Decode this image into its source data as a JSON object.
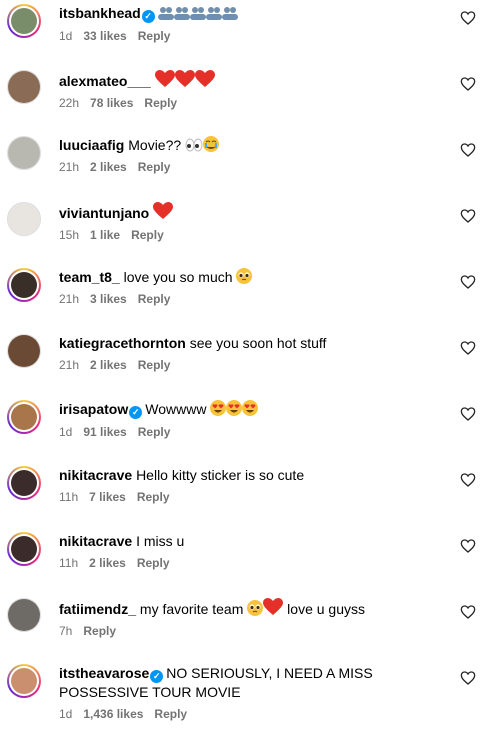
{
  "comments": [
    {
      "username": "itsbankhead",
      "verified": true,
      "text": "",
      "emoji": [
        "people",
        "people",
        "people",
        "people",
        "people"
      ],
      "time": "1d",
      "likes": "33 likes",
      "reply": "Reply",
      "avatar_color": "#7a8d6b",
      "story": true
    },
    {
      "username": "alexmateo___",
      "verified": false,
      "text": "",
      "emoji": [
        "red-heart",
        "red-heart",
        "red-heart"
      ],
      "time": "22h",
      "likes": "78 likes",
      "reply": "Reply",
      "avatar_color": "#8a6b55",
      "story": false
    },
    {
      "username": "luuciaafig",
      "verified": false,
      "text": "Movie??",
      "emoji": [
        "eyes",
        "crying-face"
      ],
      "time": "21h",
      "likes": "2 likes",
      "reply": "Reply",
      "avatar_color": "#b8b8b0",
      "story": false
    },
    {
      "username": "viviantunjano",
      "verified": false,
      "text": "",
      "emoji": [
        "red-heart"
      ],
      "time": "15h",
      "likes": "1 like",
      "reply": "Reply",
      "avatar_color": "#e8e4e0",
      "story": false
    },
    {
      "username": "team_t8_",
      "verified": false,
      "text": "love you so much",
      "emoji": [
        "pleading-face"
      ],
      "time": "21h",
      "likes": "3 likes",
      "reply": "Reply",
      "avatar_color": "#3a2e28",
      "story": true
    },
    {
      "username": "katiegracethornton",
      "verified": false,
      "text": "see you soon hot stuff",
      "emoji": [],
      "time": "21h",
      "likes": "2 likes",
      "reply": "Reply",
      "avatar_color": "#6b4a35",
      "story": false
    },
    {
      "username": "irisapatow",
      "verified": true,
      "text": "Wowwww",
      "emoji": [
        "heart-eyes",
        "heart-eyes",
        "heart-eyes"
      ],
      "time": "1d",
      "likes": "91 likes",
      "reply": "Reply",
      "avatar_color": "#a8764a",
      "story": true
    },
    {
      "username": "nikitacrave",
      "verified": false,
      "text": "Hello kitty sticker is so cute",
      "emoji": [],
      "time": "11h",
      "likes": "7 likes",
      "reply": "Reply",
      "avatar_color": "#3b2b2b",
      "story": true
    },
    {
      "username": "nikitacrave",
      "verified": false,
      "text": "I miss u",
      "emoji": [],
      "time": "11h",
      "likes": "2 likes",
      "reply": "Reply",
      "avatar_color": "#3b2b2b",
      "story": true
    },
    {
      "username": "fatiimendz_",
      "verified": false,
      "text": "my favorite team",
      "emoji": [
        "pleading-face",
        "red-heart"
      ],
      "text_after": "love u guyss",
      "time": "7h",
      "likes": "",
      "reply": "Reply",
      "avatar_color": "#6e6a66",
      "story": false
    },
    {
      "username": "itstheavarose",
      "verified": true,
      "text": "NO SERIOUSLY, I NEED A MISS",
      "text_line2": "POSSESSIVE TOUR MOVIE",
      "emoji": [],
      "time": "1d",
      "likes": "1,436 likes",
      "reply": "Reply",
      "avatar_color": "#c98f6e",
      "story": true
    }
  ],
  "icons": {
    "like": "heart-outline-icon",
    "verified": "verified-badge-icon"
  },
  "colors": {
    "meta": "#737373",
    "verified": "#0095f6",
    "heart": "#ed4956"
  }
}
